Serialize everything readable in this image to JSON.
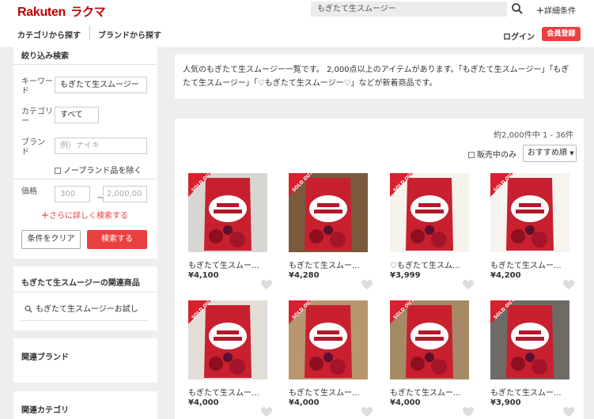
{
  "header": {
    "logo_main": "Rakuten",
    "logo_sub": "ラクマ",
    "search_value": "もぎたて生スムージー",
    "detail_label": "詳細条件",
    "nav_category": "カテゴリから探す",
    "nav_brand": "ブランドから探す",
    "login": "ログイン",
    "register": "会員登録"
  },
  "filter": {
    "title": "絞り込み検索",
    "keyword_label": "キーワード",
    "keyword_value": "もぎたて生スムージー",
    "category_label": "カテゴリー",
    "category_value": "すべて",
    "brand_label": "ブランド",
    "brand_placeholder": "例）ナイキ",
    "no_brand": "ノーブランド品を除く",
    "price_label": "価格",
    "price_min_placeholder": "300",
    "price_max_placeholder": "2,000,00",
    "price_sep": "〜",
    "more": "さらに詳しく検索する",
    "clear": "条件をクリア",
    "search": "検索する"
  },
  "related": {
    "title": "もぎたて生スムージーの関連商品",
    "item": "もぎたて生スムージーお試し"
  },
  "brands": {
    "title": "関連ブランド"
  },
  "categories": {
    "title": "関連カテゴリ"
  },
  "description": "人気のもぎたて生スムージー一覧です。 2,000点以上のアイテムがあります。「もぎたて生スムージー」「もぎたて生スムージー」「♡もぎたて生スムージー♡」などが新着商品です。",
  "results": {
    "count": "約2,000件中 1 - 36件",
    "on_sale": "販売中のみ",
    "sort": "おすすめ順"
  },
  "colors": {
    "brand_red": "#bf0000",
    "accent_red": "#e94040",
    "sold_out": "#d8212f"
  },
  "products": [
    {
      "name": "もぎたて生スムー...",
      "price": "¥4,100",
      "sold_out": true
    },
    {
      "name": "もぎたて生スムー...",
      "price": "¥4,280",
      "sold_out": true
    },
    {
      "name": "♡もぎたて生スム...",
      "price": "¥3,999",
      "sold_out": true
    },
    {
      "name": "もぎたて生スムー...",
      "price": "¥4,200",
      "sold_out": true
    },
    {
      "name": "もぎたて生スムー...",
      "price": "¥4,000",
      "sold_out": true
    },
    {
      "name": "もぎたて生スムー...",
      "price": "¥4,000",
      "sold_out": true
    },
    {
      "name": "もぎたて生スムー...",
      "price": "¥4,000",
      "sold_out": true
    },
    {
      "name": "もぎたて生スムー...",
      "price": "¥3,900",
      "sold_out": true
    }
  ],
  "sold_out_label": "SOLD OUT"
}
